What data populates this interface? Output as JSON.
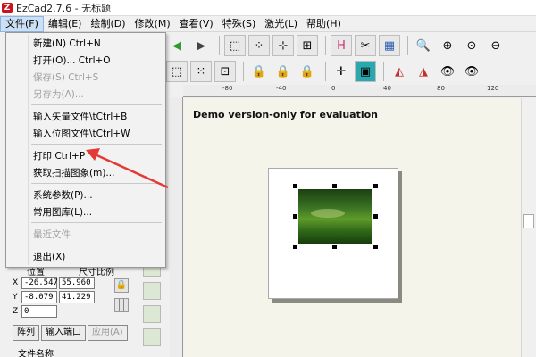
{
  "window": {
    "title": "EzCad2.7.6 - 无标题",
    "icon": "ezcad-app-icon"
  },
  "menubar": {
    "items": [
      {
        "label": "文件(F)",
        "active": true
      },
      {
        "label": "编辑(E)"
      },
      {
        "label": "绘制(D)"
      },
      {
        "label": "修改(M)"
      },
      {
        "label": "查看(V)"
      },
      {
        "label": "特殊(S)"
      },
      {
        "label": "激光(L)"
      },
      {
        "label": "帮助(H)"
      }
    ]
  },
  "file_menu": {
    "items": [
      {
        "label": "新建(N) Ctrl+N",
        "enabled": true
      },
      {
        "label": "打开(O)... Ctrl+O",
        "enabled": true
      },
      {
        "label": "保存(S) Ctrl+S",
        "enabled": false
      },
      {
        "label": "另存为(A)...",
        "enabled": false
      },
      {
        "label": "输入矢量文件\\tCtrl+B",
        "enabled": true
      },
      {
        "label": "输入位图文件\\tCtrl+W",
        "enabled": true
      },
      {
        "label": "打印 Ctrl+P",
        "enabled": true
      },
      {
        "label": "获取扫描图象(m)...",
        "enabled": true
      },
      {
        "label": "系统参数(P)...",
        "enabled": true
      },
      {
        "label": "常用图库(L)...",
        "enabled": true
      },
      {
        "label": "最近文件",
        "enabled": false
      },
      {
        "label": "退出(X)",
        "enabled": true
      }
    ]
  },
  "toolbar1": {
    "icons": [
      "back-icon",
      "forward-icon",
      "select-icon",
      "node-edit-icon",
      "array-icon",
      "group-icon",
      "h-char-icon",
      "tool-icon",
      "grid-icon",
      "zoom-icon",
      "zoom-in-icon",
      "zoom-fit-icon",
      "zoom-out-icon"
    ]
  },
  "toolbar2": {
    "icons": [
      "select-all-icon",
      "select-node-icon",
      "select-frame-icon",
      "lock-icon",
      "lock-icon-2",
      "lock-icon-3",
      "crosshair-icon",
      "color-icon",
      "mirror-h-icon",
      "mirror-v-icon",
      "view-icon",
      "view-icon-2"
    ]
  },
  "ruler": {
    "labels": [
      "-80",
      "-40",
      "0",
      "40",
      "80",
      "120"
    ]
  },
  "canvas": {
    "demo_text": "Demo version-only for evaluation"
  },
  "properties": {
    "position_label": "位置",
    "size_label": "尺寸比例",
    "x_label": "X",
    "y_label": "Y",
    "z_label": "Z",
    "x_pos": "-26.547",
    "x_size": "55.960",
    "y_pos": "-8.079",
    "y_size": "41.229",
    "z_val": "0"
  },
  "bottom_buttons": {
    "array": "阵列",
    "input_port": "输入端口",
    "apply": "应用(A)"
  },
  "file_name_label": "文件名称",
  "colors": {
    "arrow": "#e53935",
    "menu_highlight": "#cce0f5",
    "canvas_bg": "#f5f4ea"
  }
}
